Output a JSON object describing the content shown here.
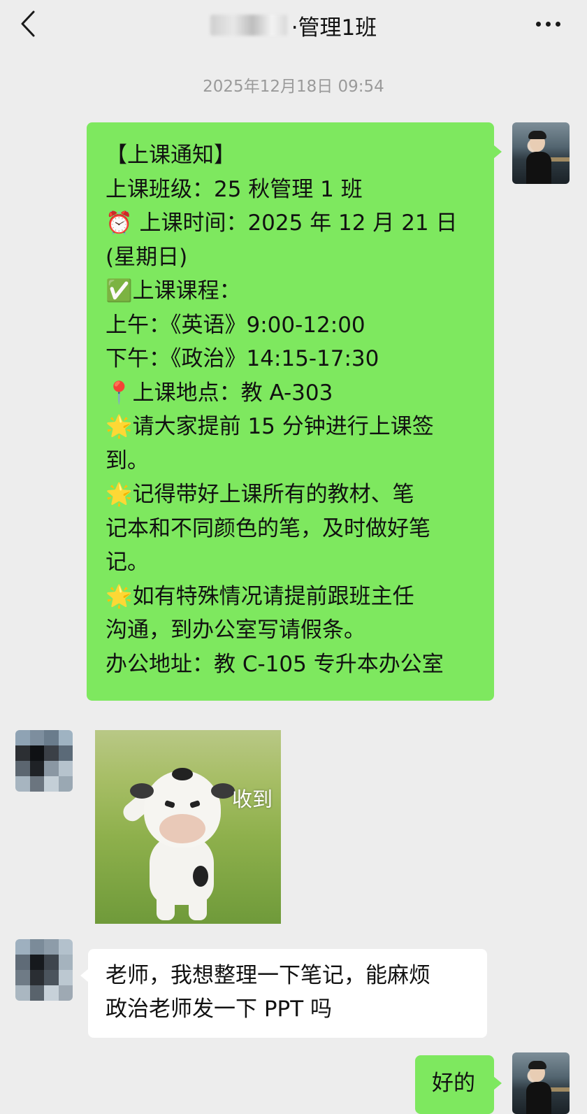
{
  "header": {
    "title_suffix": "·管理1班",
    "back_icon": "chevron-left-icon",
    "more_icon": "more-dots-icon"
  },
  "timestamp": "2025年12月18日 09:54",
  "messages": {
    "notice": {
      "lines": [
        "【上课通知】",
        "上课班级：25 秋管理 1 班",
        "⏰ 上课时间：2025 年 12 月 21 日",
        "(星期日)",
        "✅上课课程：",
        "上午：《英语》9:00-12:00",
        "下午：《政治》14:15-17:30",
        "📍上课地点：教 A-303",
        "🌟请大家提前 15 分钟进行上课签",
        "到。",
        "🌟记得带好上课所有的教材、笔",
        "记本和不同颜色的笔，及时做好笔",
        "记。",
        "🌟如有特殊情况请提前跟班主任",
        "沟通，到办公室写请假条。",
        "办公地址：教 C-105 专升本办公室"
      ]
    },
    "sticker": {
      "caption": "收到"
    },
    "student_question": {
      "lines": [
        "老师，我想整理一下笔记，能麻烦",
        "政治老师发一下 PPT 吗"
      ]
    },
    "reply": {
      "text": "好的"
    }
  },
  "colors": {
    "background": "#ededed",
    "self_bubble": "#7ee85f",
    "other_bubble": "#ffffff",
    "timestamp": "#9a9a9a"
  }
}
